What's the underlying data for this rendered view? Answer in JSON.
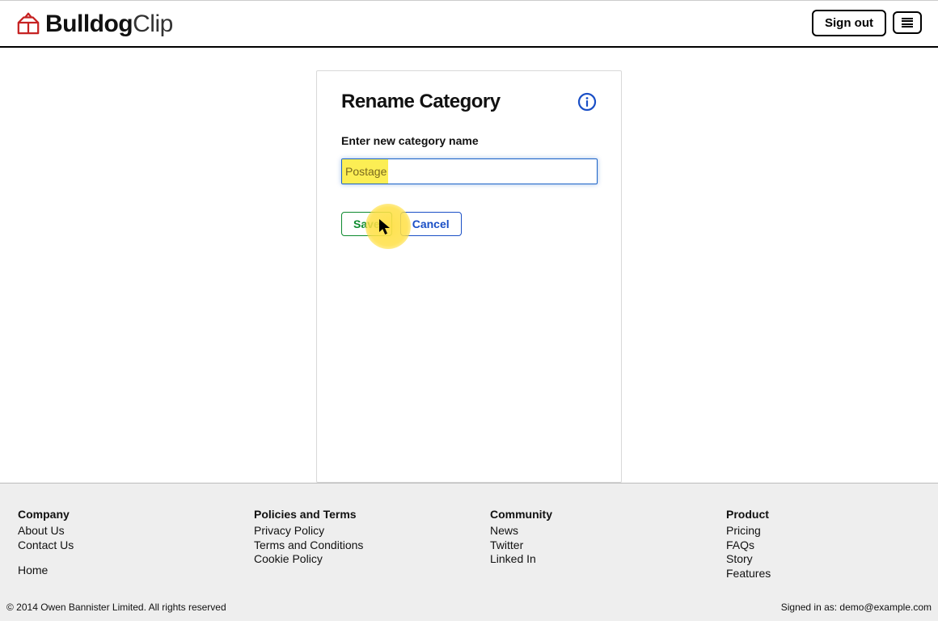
{
  "header": {
    "brand_bold": "Bulldog",
    "brand_light": "Clip",
    "sign_out": "Sign out"
  },
  "card": {
    "title": "Rename Category",
    "field_label": "Enter new category name",
    "input_value": "Postage",
    "save_label": "Save",
    "cancel_label": "Cancel"
  },
  "footer": {
    "company": {
      "heading": "Company",
      "about": "About Us",
      "contact": "Contact Us",
      "home": "Home"
    },
    "policies": {
      "heading": "Policies and Terms",
      "privacy": "Privacy Policy",
      "terms": "Terms and Conditions",
      "cookie": "Cookie Policy"
    },
    "community": {
      "heading": "Community",
      "news": "News",
      "twitter": "Twitter",
      "linkedin": "Linked In"
    },
    "product": {
      "heading": "Product",
      "pricing": "Pricing",
      "faqs": "FAQs",
      "story": "Story",
      "features": "Features"
    },
    "copyright": "© 2014 Owen Bannister Limited. All rights reserved",
    "signed_in": "Signed in as: demo@example.com"
  }
}
